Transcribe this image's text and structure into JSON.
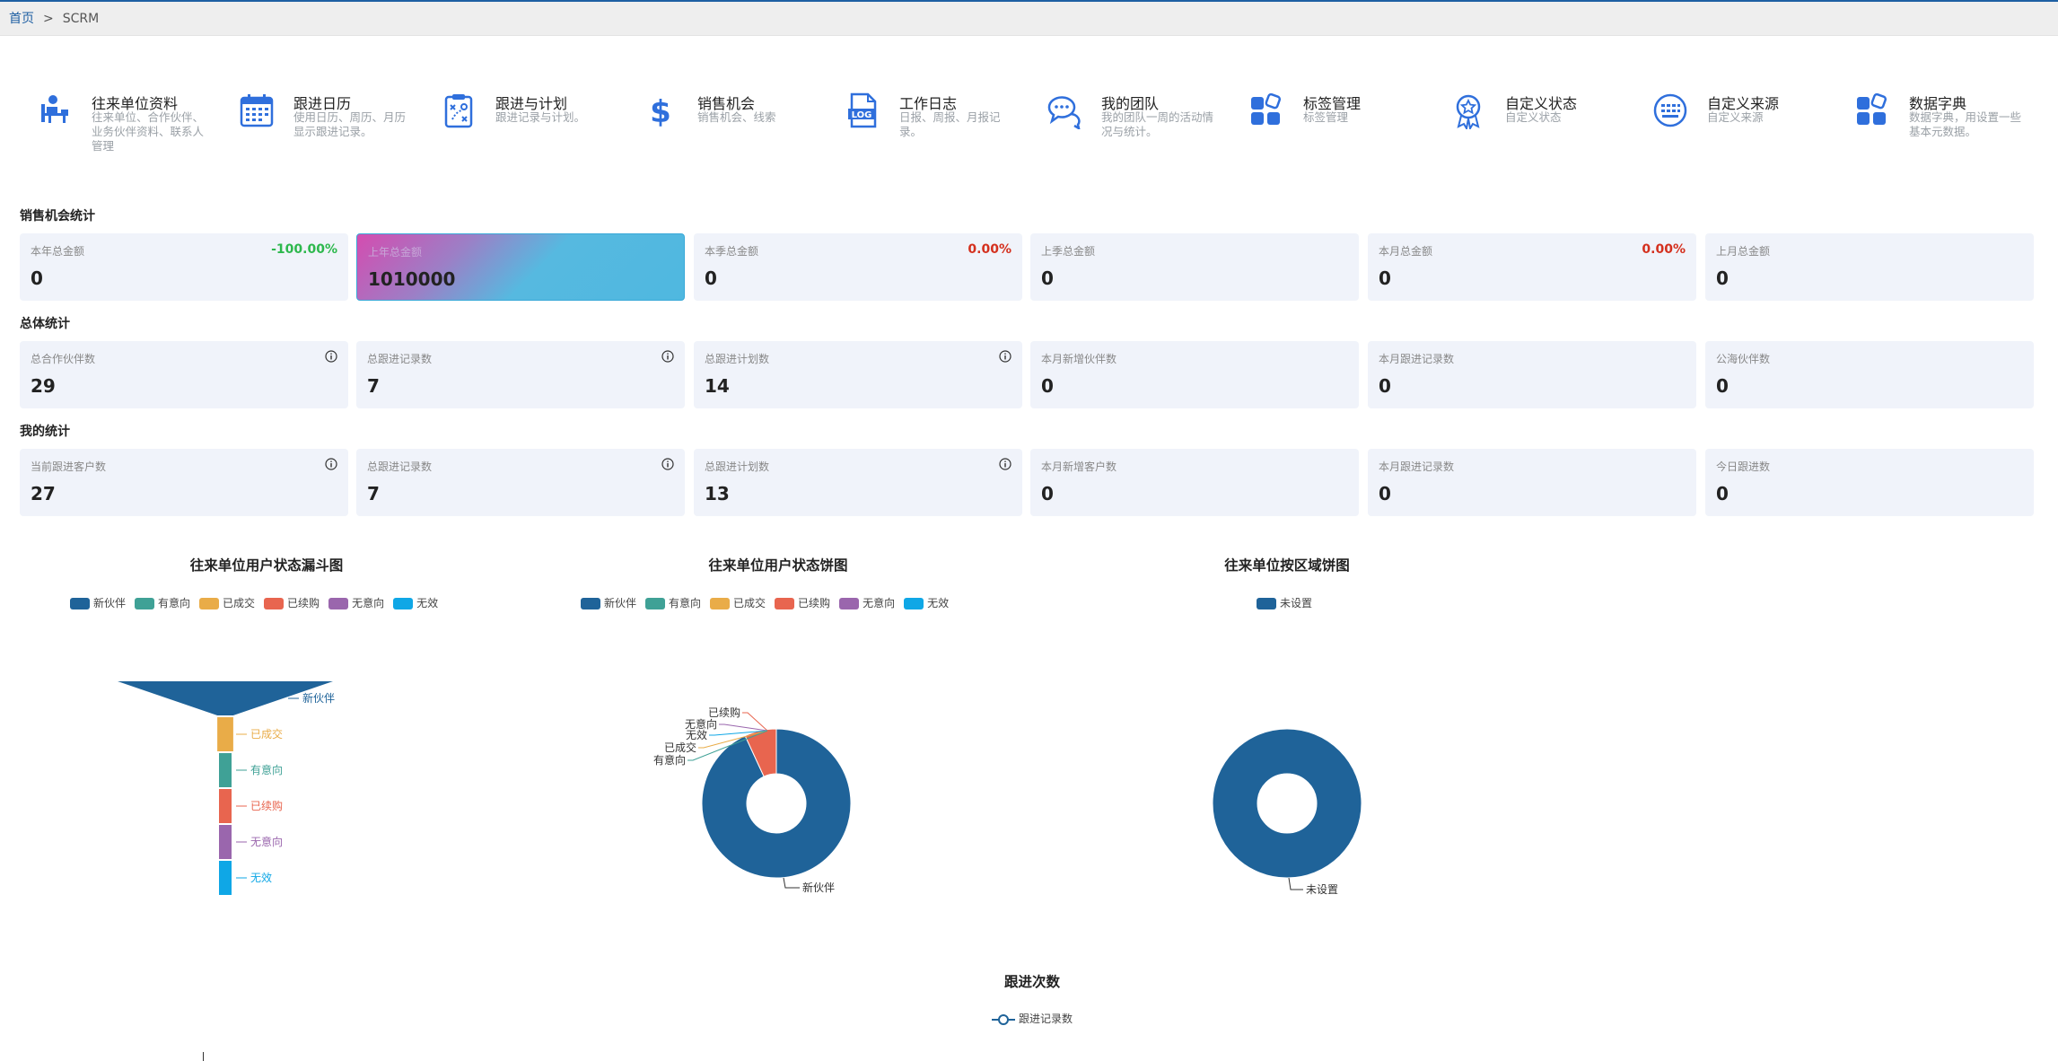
{
  "breadcrumb": {
    "home": "首页",
    "separator": ">",
    "current": "SCRM"
  },
  "modules": [
    {
      "title": "往来单位资料",
      "desc": "往来单位、合作伙伴、业务伙伴资料、联系人管理",
      "icon": "person-desk-icon"
    },
    {
      "title": "跟进日历",
      "desc": "使用日历、周历、月历显示跟进记录。",
      "icon": "calendar-icon"
    },
    {
      "title": "跟进与计划",
      "desc": "跟进记录与计划。",
      "icon": "clipboard-plan-icon"
    },
    {
      "title": "销售机会",
      "desc": "销售机会、线索",
      "icon": "dollar-icon"
    },
    {
      "title": "工作日志",
      "desc": "日报、周报、月报记录。",
      "icon": "log-file-icon"
    },
    {
      "title": "我的团队",
      "desc": "我的团队一周的活动情况与统计。",
      "icon": "chat-bubbles-icon"
    },
    {
      "title": "标签管理",
      "desc": "标签管理",
      "icon": "tiles-icon"
    },
    {
      "title": "自定义状态",
      "desc": "自定义状态",
      "icon": "badge-star-icon"
    },
    {
      "title": "自定义来源",
      "desc": "自定义来源",
      "icon": "keypad-icon"
    },
    {
      "title": "数据字典",
      "desc": "数据字典，用设置一些基本元数据。",
      "icon": "tiles-icon"
    }
  ],
  "sections": {
    "sales": "销售机会统计",
    "overall": "总体统计",
    "mine": "我的统计"
  },
  "sales_cards": [
    {
      "label": "本年总金额",
      "value": "0",
      "change": "-100.00%",
      "change_color": "#2db84d"
    },
    {
      "label": "上年总金额",
      "value": "1010000",
      "change": "",
      "change_color": ""
    },
    {
      "label": "本季总金额",
      "value": "0",
      "change": "0.00%",
      "change_color": "#d4301e"
    },
    {
      "label": "上季总金额",
      "value": "0",
      "change": "",
      "change_color": ""
    },
    {
      "label": "本月总金额",
      "value": "0",
      "change": "0.00%",
      "change_color": "#d4301e"
    },
    {
      "label": "上月总金额",
      "value": "0",
      "change": "",
      "change_color": ""
    }
  ],
  "overall_cards": [
    {
      "label": "总合作伙伴数",
      "value": "29",
      "info": true
    },
    {
      "label": "总跟进记录数",
      "value": "7",
      "info": true
    },
    {
      "label": "总跟进计划数",
      "value": "14",
      "info": true
    },
    {
      "label": "本月新增伙伴数",
      "value": "0",
      "info": false
    },
    {
      "label": "本月跟进记录数",
      "value": "0",
      "info": false
    },
    {
      "label": "公海伙伴数",
      "value": "0",
      "info": false
    }
  ],
  "my_cards": [
    {
      "label": "当前跟进客户数",
      "value": "27",
      "info": true
    },
    {
      "label": "总跟进记录数",
      "value": "7",
      "info": true
    },
    {
      "label": "总跟进计划数",
      "value": "13",
      "info": true
    },
    {
      "label": "本月新增客户数",
      "value": "0",
      "info": false
    },
    {
      "label": "本月跟进记录数",
      "value": "0",
      "info": false
    },
    {
      "label": "今日跟进数",
      "value": "0",
      "info": false
    }
  ],
  "colors": {
    "新伙伴": "#1f6399",
    "有意向": "#3fa196",
    "已成交": "#e9ac48",
    "已续购": "#e8654f",
    "无意向": "#9a66ad",
    "无效": "#0fa7e6",
    "未设置": "#1f6399"
  },
  "chart_data": [
    {
      "type": "funnel",
      "title": "往来单位用户状态漏斗图",
      "legend": [
        "新伙伴",
        "有意向",
        "已成交",
        "已续购",
        "无意向",
        "无效"
      ],
      "categories": [
        "新伙伴",
        "已成交",
        "有意向",
        "已续购",
        "无意向",
        "无效"
      ],
      "values": [
        27,
        2,
        0,
        0,
        0,
        0
      ]
    },
    {
      "type": "pie",
      "title": "往来单位用户状态饼图",
      "legend": [
        "新伙伴",
        "有意向",
        "已成交",
        "已续购",
        "无意向",
        "无效"
      ],
      "categories": [
        "新伙伴",
        "已续购",
        "无意向",
        "无效",
        "已成交",
        "有意向"
      ],
      "values": [
        27,
        2,
        0,
        0,
        0,
        0
      ]
    },
    {
      "type": "pie",
      "title": "往来单位按区域饼图",
      "legend": [
        "未设置"
      ],
      "categories": [
        "未设置"
      ],
      "values": [
        29
      ]
    },
    {
      "type": "line",
      "title": "跟进次数",
      "legend": [
        "跟进记录数"
      ],
      "series": [
        {
          "name": "跟进记录数",
          "values": []
        }
      ]
    }
  ]
}
